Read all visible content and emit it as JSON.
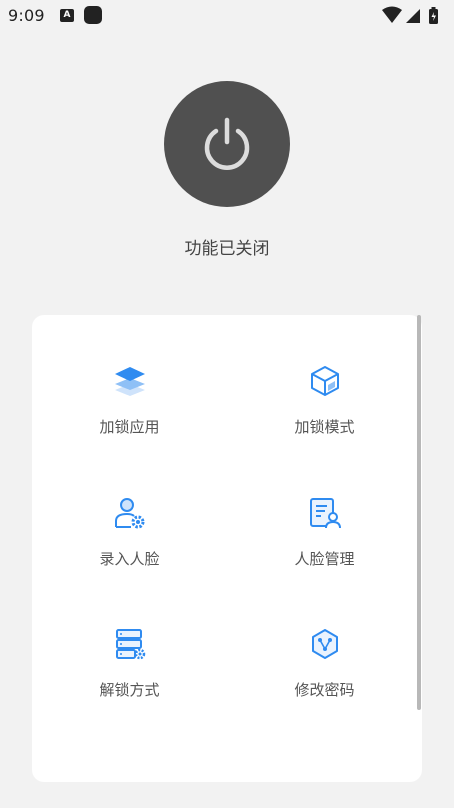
{
  "status_bar": {
    "time": "9:09",
    "a_badge": "A",
    "icons": [
      "notification-a-icon",
      "app-notification-icon",
      "wifi-icon",
      "signal-icon",
      "battery-icon"
    ]
  },
  "power": {
    "state_label": "功能已关闭",
    "icon": "power-icon"
  },
  "menu": {
    "items": [
      {
        "label": "加锁应用",
        "icon": "layers-icon"
      },
      {
        "label": "加锁模式",
        "icon": "cube-mode-icon"
      },
      {
        "label": "录入人脸",
        "icon": "user-settings-icon"
      },
      {
        "label": "人脸管理",
        "icon": "face-document-icon"
      },
      {
        "label": "解锁方式",
        "icon": "server-settings-icon"
      },
      {
        "label": "修改密码",
        "icon": "hexagon-nodes-icon"
      }
    ]
  },
  "colors": {
    "background": "#f2f2f2",
    "card": "#ffffff",
    "power_button": "#505050",
    "accent": "#2f8bf0"
  }
}
